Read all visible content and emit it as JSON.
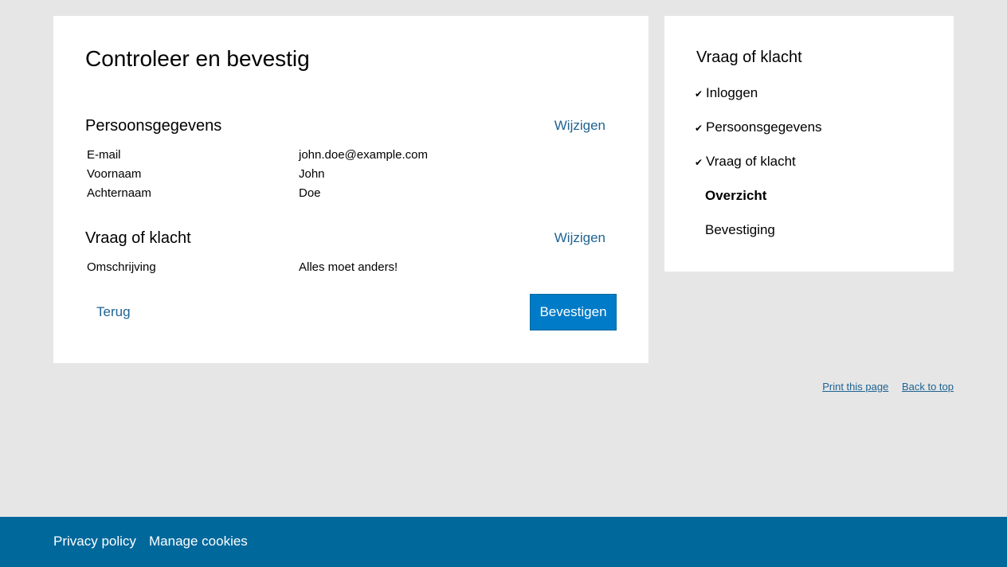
{
  "main": {
    "title": "Controleer en bevestig",
    "sections": [
      {
        "heading": "Persoonsgegevens",
        "edit_label": "Wijzigen",
        "fields": [
          {
            "label": "E-mail",
            "value": "john.doe@example.com"
          },
          {
            "label": "Voornaam",
            "value": "John"
          },
          {
            "label": "Achternaam",
            "value": "Doe"
          }
        ]
      },
      {
        "heading": "Vraag of klacht",
        "edit_label": "Wijzigen",
        "fields": [
          {
            "label": "Omschrijving",
            "value": "Alles moet anders!"
          }
        ]
      }
    ],
    "back_label": "Terug",
    "confirm_label": "Bevestigen"
  },
  "sidebar": {
    "title": "Vraag of klacht",
    "steps": [
      {
        "label": "Inloggen",
        "status": "done"
      },
      {
        "label": "Persoonsgegevens",
        "status": "done"
      },
      {
        "label": "Vraag of klacht",
        "status": "done"
      },
      {
        "label": "Overzicht",
        "status": "current"
      },
      {
        "label": "Bevestiging",
        "status": "pending"
      }
    ]
  },
  "utility": {
    "print_label": "Print this page",
    "top_label": "Back to top"
  },
  "footer": {
    "privacy_label": "Privacy policy",
    "cookies_label": "Manage cookies"
  },
  "colors": {
    "background": "#e6e6e6",
    "link": "#1f6392",
    "button": "#007bc7",
    "footer": "#01689b"
  }
}
